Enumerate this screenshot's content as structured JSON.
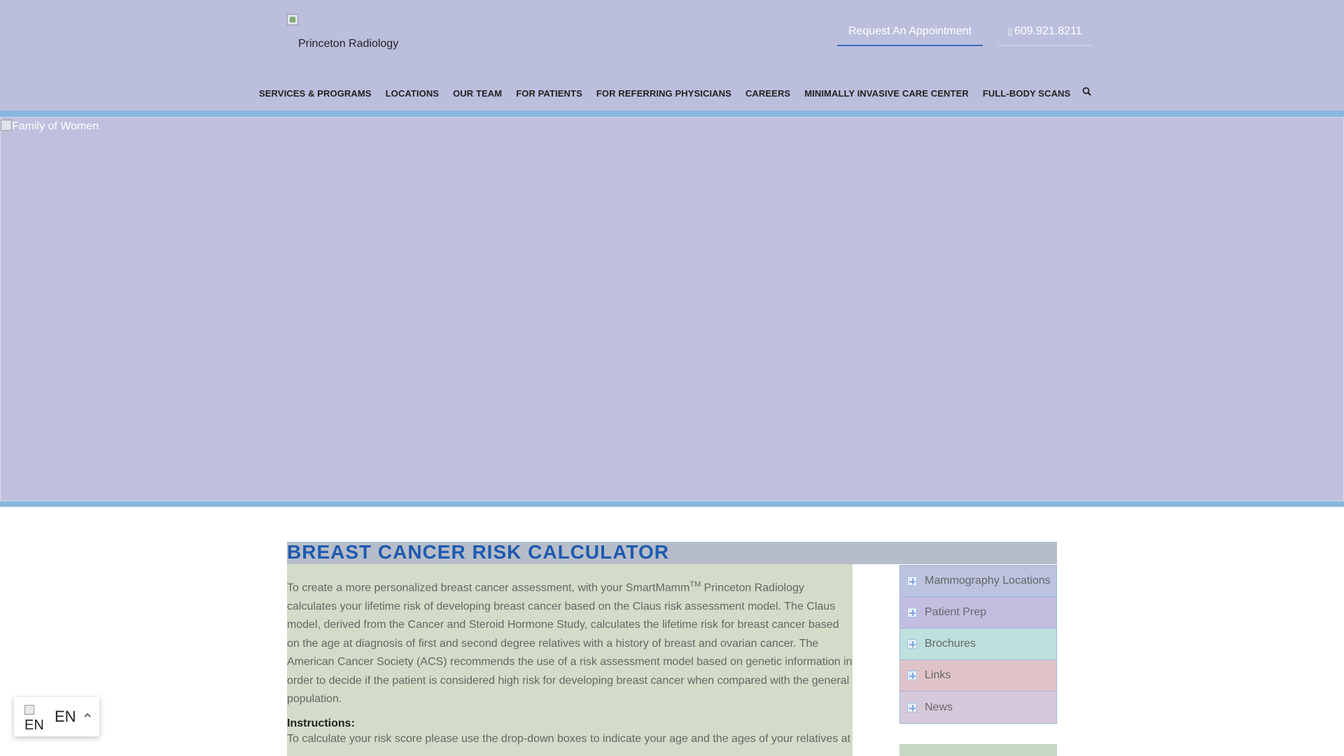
{
  "header": {
    "logo_text": "Princeton Radiology",
    "appointment_label": "Request An Appointment",
    "phone_label": "609.921.8211",
    "nav": [
      "SERVICES & PROGRAMS",
      "LOCATIONS",
      "OUR TEAM",
      "FOR PATIENTS",
      "FOR REFERRING PHYSICIANS",
      "CAREERS",
      "MINIMALLY INVASIVE CARE CENTER",
      "FULL-BODY SCANS"
    ]
  },
  "hero": {
    "alt_text": "Family of Women"
  },
  "content": {
    "title": "BREAST CANCER RISK CALCULATOR",
    "intro_part1": "To create a more personalized breast cancer assessment, with your SmartMamm",
    "intro_tm": "TM",
    "intro_part2": " Princeton Radiology calculates your lifetime risk of developing breast cancer based on the Claus risk assessment model. The Claus model, derived from the Cancer and Steroid Hormone Study, calculates the lifetime risk for breast cancer based on the age at diagnosis of first and second degree relatives with a history of breast and ovarian cancer. The American Cancer Society (ACS) recommends the use of a risk assessment model based on genetic information in order to decide if the patient is considered high risk for developing breast cancer when compared with the general population.",
    "instructions_title": "Instructions:",
    "instructions_text": "To calculate your risk score please use the drop-down boxes to indicate your age and the ages of your relatives at"
  },
  "sidebar": {
    "items": [
      {
        "label": "Mammography Locations",
        "bg": "#bcc3e0"
      },
      {
        "label": "Patient Prep",
        "bg": "#c3bde0"
      },
      {
        "label": "Brochures",
        "bg": "#bee0de"
      },
      {
        "label": "Links",
        "bg": "#e0c3c9"
      },
      {
        "label": "News",
        "bg": "#d7c9dc"
      }
    ]
  },
  "language": {
    "flag_text": "EN",
    "code": "EN"
  },
  "colors": {
    "header_bg": "#bbbfdd",
    "accent_blue": "#88b8e0",
    "title_blue": "#1e5ab0"
  }
}
